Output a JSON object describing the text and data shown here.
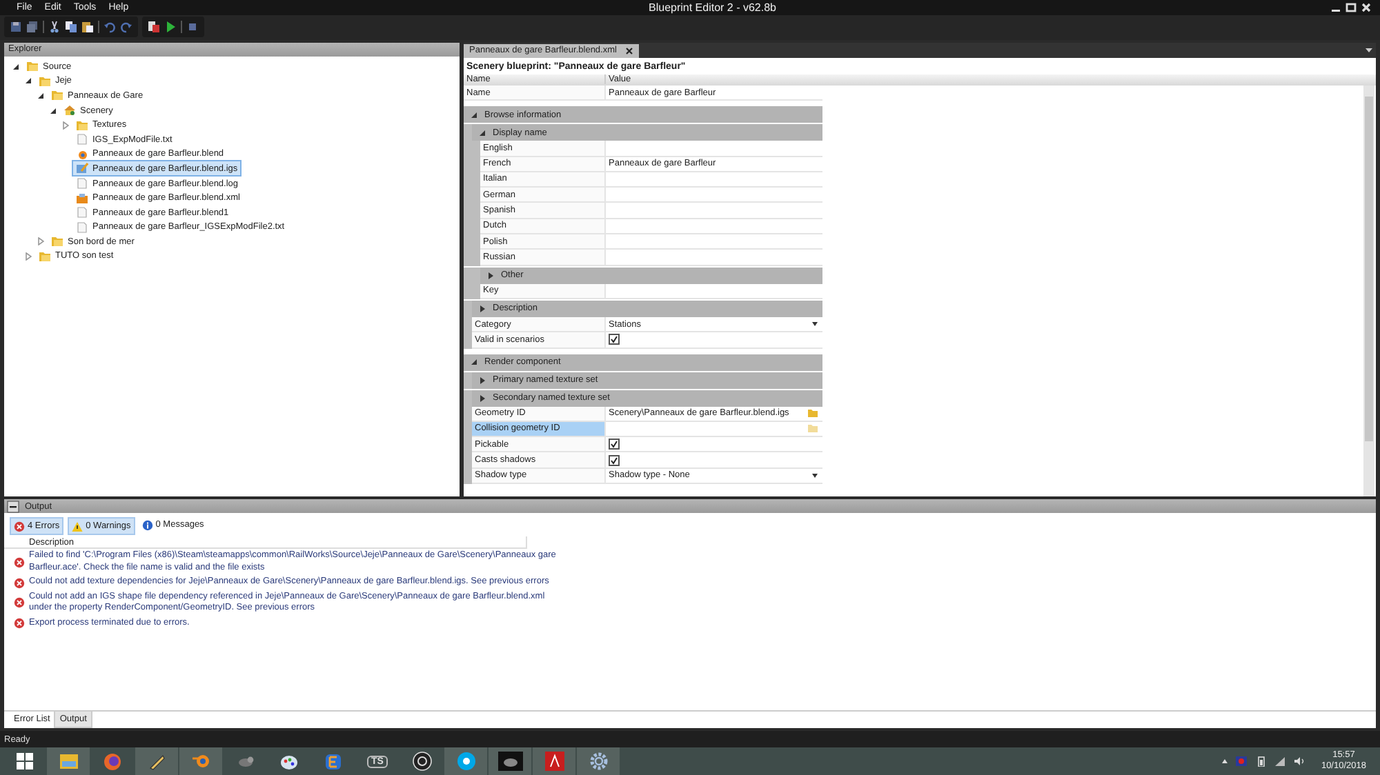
{
  "window": {
    "title": "Blueprint Editor 2 - v62.8b",
    "menu": [
      "File",
      "Edit",
      "Tools",
      "Help"
    ]
  },
  "explorer": {
    "title": "Explorer",
    "tree": [
      {
        "label": "Source",
        "kind": "folder",
        "expanded": true,
        "selected": false,
        "children": [
          {
            "label": "Jeje",
            "kind": "folder",
            "expanded": true,
            "selected": false,
            "children": [
              {
                "label": "Panneaux de Gare",
                "kind": "folder",
                "expanded": true,
                "selected": false,
                "children": [
                  {
                    "label": "Scenery",
                    "kind": "scenery",
                    "expanded": true,
                    "selected": false,
                    "children": [
                      {
                        "label": "Textures",
                        "kind": "folder",
                        "expanded": false,
                        "selected": false
                      },
                      {
                        "label": "IGS_ExpModFile.txt",
                        "kind": "file",
                        "selected": false
                      },
                      {
                        "label": "Panneaux de gare Barfleur.blend",
                        "kind": "blend",
                        "selected": false
                      },
                      {
                        "label": "Panneaux de gare Barfleur.blend.igs",
                        "kind": "shape",
                        "selected": true
                      },
                      {
                        "label": "Panneaux de gare Barfleur.blend.log",
                        "kind": "file",
                        "selected": false
                      },
                      {
                        "label": "Panneaux de gare Barfleur.blend.xml",
                        "kind": "xml",
                        "selected": false
                      },
                      {
                        "label": "Panneaux de gare Barfleur.blend1",
                        "kind": "file",
                        "selected": false
                      },
                      {
                        "label": "Panneaux de gare Barfleur_IGSExpModFile2.txt",
                        "kind": "file",
                        "selected": false
                      }
                    ]
                  }
                ]
              },
              {
                "label": "Son bord de mer",
                "kind": "folder",
                "expanded": false,
                "selected": false
              }
            ]
          },
          {
            "label": "TUTO son test",
            "kind": "folder",
            "expanded": false,
            "selected": false
          }
        ]
      }
    ]
  },
  "document": {
    "tab": "Panneaux de gare Barfleur.blend.xml",
    "heading": "Scenery blueprint: \"Panneaux de gare Barfleur\"",
    "columns": [
      "Name",
      "Value"
    ],
    "properties": [
      {
        "kind": "field",
        "name": "Name",
        "value": "Panneaux de gare Barfleur",
        "selected": false
      },
      {
        "kind": "group",
        "label": "Browse information",
        "expanded": true,
        "children": [
          {
            "kind": "group",
            "label": "Display name",
            "expanded": true,
            "children": [
              {
                "kind": "field",
                "name": "English",
                "selected": false
              },
              {
                "kind": "field",
                "name": "French",
                "value": "Panneaux de gare Barfleur",
                "selected": false
              },
              {
                "kind": "field",
                "name": "Italian",
                "selected": false
              },
              {
                "kind": "field",
                "name": "German",
                "selected": false
              },
              {
                "kind": "field",
                "name": "Spanish",
                "selected": false
              },
              {
                "kind": "field",
                "name": "Dutch",
                "selected": false
              },
              {
                "kind": "field",
                "name": "Polish",
                "selected": false
              },
              {
                "kind": "field",
                "name": "Russian",
                "selected": false
              },
              {
                "kind": "group",
                "label": "Other",
                "expanded": false
              },
              {
                "kind": "field",
                "name": "Key",
                "selected": false
              }
            ]
          },
          {
            "kind": "group",
            "label": "Description",
            "expanded": false
          },
          {
            "kind": "dropdown",
            "name": "Category",
            "value": "Stations",
            "selected": false
          },
          {
            "kind": "checkbox",
            "name": "Valid in scenarios",
            "checked": true,
            "selected": false
          }
        ]
      },
      {
        "kind": "group",
        "label": "Render component",
        "expanded": true,
        "children": [
          {
            "kind": "group",
            "label": "Primary named texture set",
            "expanded": false
          },
          {
            "kind": "group",
            "label": "Secondary named texture set",
            "expanded": false
          },
          {
            "kind": "path",
            "name": "Geometry ID",
            "value": "Scenery\\Panneaux de gare Barfleur.blend.igs",
            "selected": false
          },
          {
            "kind": "path",
            "name": "Collision geometry ID",
            "selected": true
          },
          {
            "kind": "checkbox",
            "name": "Pickable",
            "checked": true,
            "selected": false
          },
          {
            "kind": "checkbox",
            "name": "Casts shadows",
            "checked": true,
            "selected": false
          },
          {
            "kind": "dropdown",
            "name": "Shadow type",
            "value": "Shadow type - None",
            "selected": false
          }
        ]
      }
    ]
  },
  "output": {
    "title": "Output",
    "filters": [
      {
        "kind": "error",
        "label": "4 Errors",
        "selected": true
      },
      {
        "kind": "warning",
        "label": "0 Warnings",
        "selected": true
      },
      {
        "kind": "info",
        "label": "0 Messages",
        "selected": false
      }
    ],
    "column": "Description",
    "messages": [
      {
        "kind": "error",
        "lines": [
          "Failed to find 'C:\\Program Files (x86)\\Steam\\steamapps\\common\\RailWorks\\Source\\Jeje\\Panneaux de Gare\\Scenery\\Panneaux gare",
          "Barfleur.ace'. Check the file name is valid and the file exists"
        ]
      },
      {
        "kind": "error",
        "lines": [
          "Could not add texture dependencies for Jeje\\Panneaux de Gare\\Scenery\\Panneaux de gare Barfleur.blend.igs. See previous errors"
        ]
      },
      {
        "kind": "error",
        "lines": [
          "Could not add an IGS shape file dependency referenced in Jeje\\Panneaux de Gare\\Scenery\\Panneaux de gare Barfleur.blend.xml",
          "under the property RenderComponent/GeometryID. See previous errors"
        ]
      },
      {
        "kind": "error",
        "lines": [
          "Export process terminated due to errors."
        ]
      }
    ],
    "tabs": [
      {
        "label": "Error List",
        "selected": true
      },
      {
        "label": "Output",
        "selected": false
      }
    ]
  },
  "status_bar": "Ready",
  "taskbar": {
    "logo_text": "TS",
    "time": "15:57",
    "date": "10/10/2018"
  }
}
